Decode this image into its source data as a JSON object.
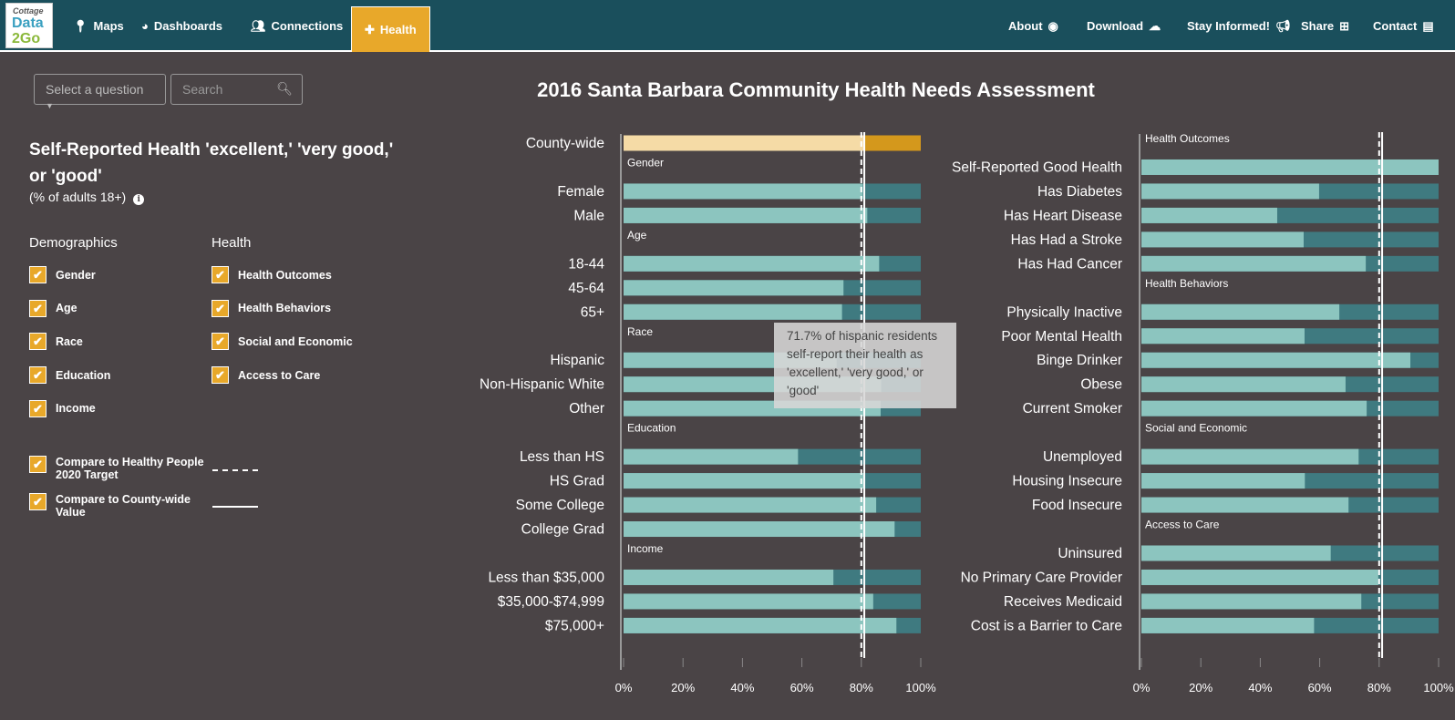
{
  "nav": {
    "logo": {
      "line1": "Cottage",
      "line2": "Data",
      "line3": "2Go"
    },
    "left": [
      {
        "label": "Maps",
        "icon": "map-marker-icon"
      },
      {
        "label": "Dashboards",
        "icon": "dashboard-icon"
      },
      {
        "label": "Connections",
        "icon": "users-icon"
      },
      {
        "label": "Health",
        "icon": "medkit-icon",
        "active": true
      }
    ],
    "right": [
      {
        "label": "About",
        "icon": "user-circle-icon"
      },
      {
        "label": "Download",
        "icon": "cloud-download-icon"
      },
      {
        "label": "Stay Informed!",
        "icon": "bullhorn-icon"
      },
      {
        "label": "Share",
        "icon": "share-icon"
      },
      {
        "label": "Contact",
        "icon": "address-card-icon"
      }
    ]
  },
  "controls": {
    "select_label": "Select a question",
    "search_placeholder": "Search"
  },
  "page_title": "2016 Santa Barbara Community Health Needs Assessment",
  "question": {
    "title": "Self-Reported Health 'excellent,' 'very good,' or 'good'",
    "subtitle": "(% of adults 18+)"
  },
  "filters": {
    "demographics_label": "Demographics",
    "health_label": "Health",
    "demographics": [
      "Gender",
      "Age",
      "Race",
      "Education",
      "Income"
    ],
    "health": [
      "Health Outcomes",
      "Health Behaviors",
      "Social and Economic",
      "Access to Care"
    ],
    "compare": [
      {
        "label": "Compare to Healthy People 2020 Target",
        "style": "dashed"
      },
      {
        "label": "Compare to County-wide Value",
        "style": "solid"
      }
    ]
  },
  "tooltip": "71.7% of hispanic residents self-report their health as 'excellent,' 'very good,' or 'good'",
  "colors": {
    "nav": "#1a4f5c",
    "accent": "#e8a82a",
    "bar_light": "#8cc5bf",
    "bar_dark": "#3f7a80",
    "county_light": "#f5dba6",
    "county_dark": "#d4981c",
    "background": "#4a4446"
  },
  "chart_data": [
    {
      "type": "bar",
      "orientation": "horizontal",
      "xlim": [
        0,
        100
      ],
      "xticks": [
        "0%",
        "20%",
        "40%",
        "60%",
        "80%",
        "100%"
      ],
      "target": 80,
      "county_value": 81,
      "rows": [
        {
          "label": "County-wide",
          "value": 81,
          "county": true
        },
        {
          "header": "Gender"
        },
        {
          "label": "Female",
          "value": 80.5
        },
        {
          "label": "Male",
          "value": 82
        },
        {
          "header": "Age"
        },
        {
          "label": "18-44",
          "value": 86
        },
        {
          "label": "45-64",
          "value": 74
        },
        {
          "label": "65+",
          "value": 73.5
        },
        {
          "header": "Race"
        },
        {
          "label": "Hispanic",
          "value": 71.7
        },
        {
          "label": "Non-Hispanic White",
          "value": 86.7
        },
        {
          "label": "Other",
          "value": 86.5
        },
        {
          "header": "Education"
        },
        {
          "label": "Less than HS",
          "value": 58.7
        },
        {
          "label": "HS Grad",
          "value": 81.2
        },
        {
          "label": "Some College",
          "value": 85
        },
        {
          "label": "College Grad",
          "value": 91.2
        },
        {
          "header": "Income"
        },
        {
          "label": "Less than $35,000",
          "value": 70.6
        },
        {
          "label": "$35,000-$74,999",
          "value": 84
        },
        {
          "label": "$75,000+",
          "value": 91.8
        }
      ]
    },
    {
      "type": "bar",
      "orientation": "horizontal",
      "xlim": [
        0,
        100
      ],
      "xticks": [
        "0%",
        "20%",
        "40%",
        "60%",
        "80%",
        "100%"
      ],
      "target": 80,
      "county_value": 81,
      "rows": [
        {
          "header": "Health Outcomes"
        },
        {
          "label": "Self-Reported Good Health",
          "value": 100
        },
        {
          "label": "Has Diabetes",
          "value": 59.8
        },
        {
          "label": "Has Heart Disease",
          "value": 45.7
        },
        {
          "label": "Has Had a Stroke",
          "value": 54.6
        },
        {
          "label": "Has Had Cancer",
          "value": 75.5
        },
        {
          "header": "Health Behaviors"
        },
        {
          "label": "Physically Inactive",
          "value": 66.6
        },
        {
          "label": "Poor Mental Health",
          "value": 54.9
        },
        {
          "label": "Binge Drinker",
          "value": 90.5
        },
        {
          "label": "Obese",
          "value": 68.7
        },
        {
          "label": "Current Smoker",
          "value": 75.8
        },
        {
          "header": "Social and Economic"
        },
        {
          "label": "Unemployed",
          "value": 73.1
        },
        {
          "label": "Housing Insecure",
          "value": 55
        },
        {
          "label": "Food Insecure",
          "value": 69.7
        },
        {
          "header": "Access to Care"
        },
        {
          "label": "Uninsured",
          "value": 63.7
        },
        {
          "label": "No Primary Care Provider",
          "value": 79.7
        },
        {
          "label": "Receives Medicaid",
          "value": 74
        },
        {
          "label": "Cost is a Barrier to Care",
          "value": 58.1
        }
      ]
    }
  ]
}
